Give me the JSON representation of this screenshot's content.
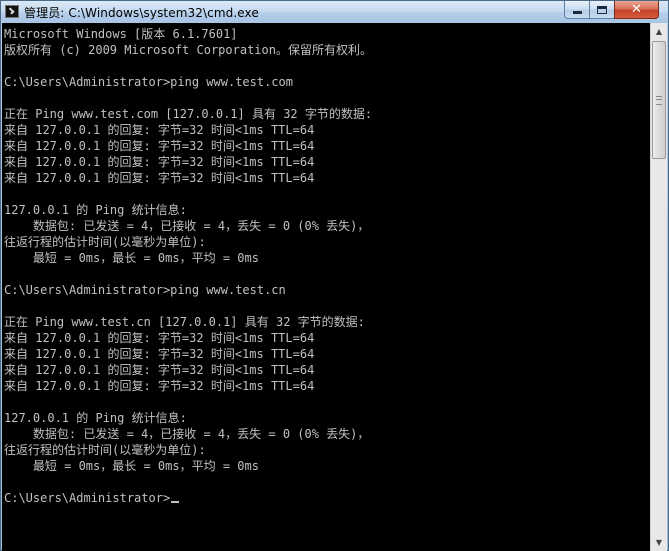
{
  "window": {
    "title": "管理员: C:\\Windows\\system32\\cmd.exe",
    "icon": "cmd-icon",
    "buttons": {
      "minimize": "minimize-icon",
      "maximize": "maximize-icon",
      "close": "close-icon",
      "close_glyph": "✕"
    }
  },
  "console": {
    "lines": [
      "Microsoft Windows [版本 6.1.7601]",
      "版权所有 (c) 2009 Microsoft Corporation。保留所有权利。",
      "",
      "C:\\Users\\Administrator>ping www.test.com",
      "",
      "正在 Ping www.test.com [127.0.0.1] 具有 32 字节的数据:",
      "来自 127.0.0.1 的回复: 字节=32 时间<1ms TTL=64",
      "来自 127.0.0.1 的回复: 字节=32 时间<1ms TTL=64",
      "来自 127.0.0.1 的回复: 字节=32 时间<1ms TTL=64",
      "来自 127.0.0.1 的回复: 字节=32 时间<1ms TTL=64",
      "",
      "127.0.0.1 的 Ping 统计信息:",
      "    数据包: 已发送 = 4，已接收 = 4，丢失 = 0 (0% 丢失)，",
      "往返行程的估计时间(以毫秒为单位):",
      "    最短 = 0ms，最长 = 0ms，平均 = 0ms",
      "",
      "C:\\Users\\Administrator>ping www.test.cn",
      "",
      "正在 Ping www.test.cn [127.0.0.1] 具有 32 字节的数据:",
      "来自 127.0.0.1 的回复: 字节=32 时间<1ms TTL=64",
      "来自 127.0.0.1 的回复: 字节=32 时间<1ms TTL=64",
      "来自 127.0.0.1 的回复: 字节=32 时间<1ms TTL=64",
      "来自 127.0.0.1 的回复: 字节=32 时间<1ms TTL=64",
      "",
      "127.0.0.1 的 Ping 统计信息:",
      "    数据包: 已发送 = 4，已接收 = 4，丢失 = 0 (0% 丢失)，",
      "往返行程的估计时间(以毫秒为单位):",
      "    最短 = 0ms，最长 = 0ms，平均 = 0ms",
      "",
      "C:\\Users\\Administrator>"
    ],
    "text_color": "#c0c0c0",
    "background_color": "#000000"
  },
  "scrollbar": {
    "up_arrow": "▲",
    "down_arrow": "▼",
    "position": 0
  }
}
